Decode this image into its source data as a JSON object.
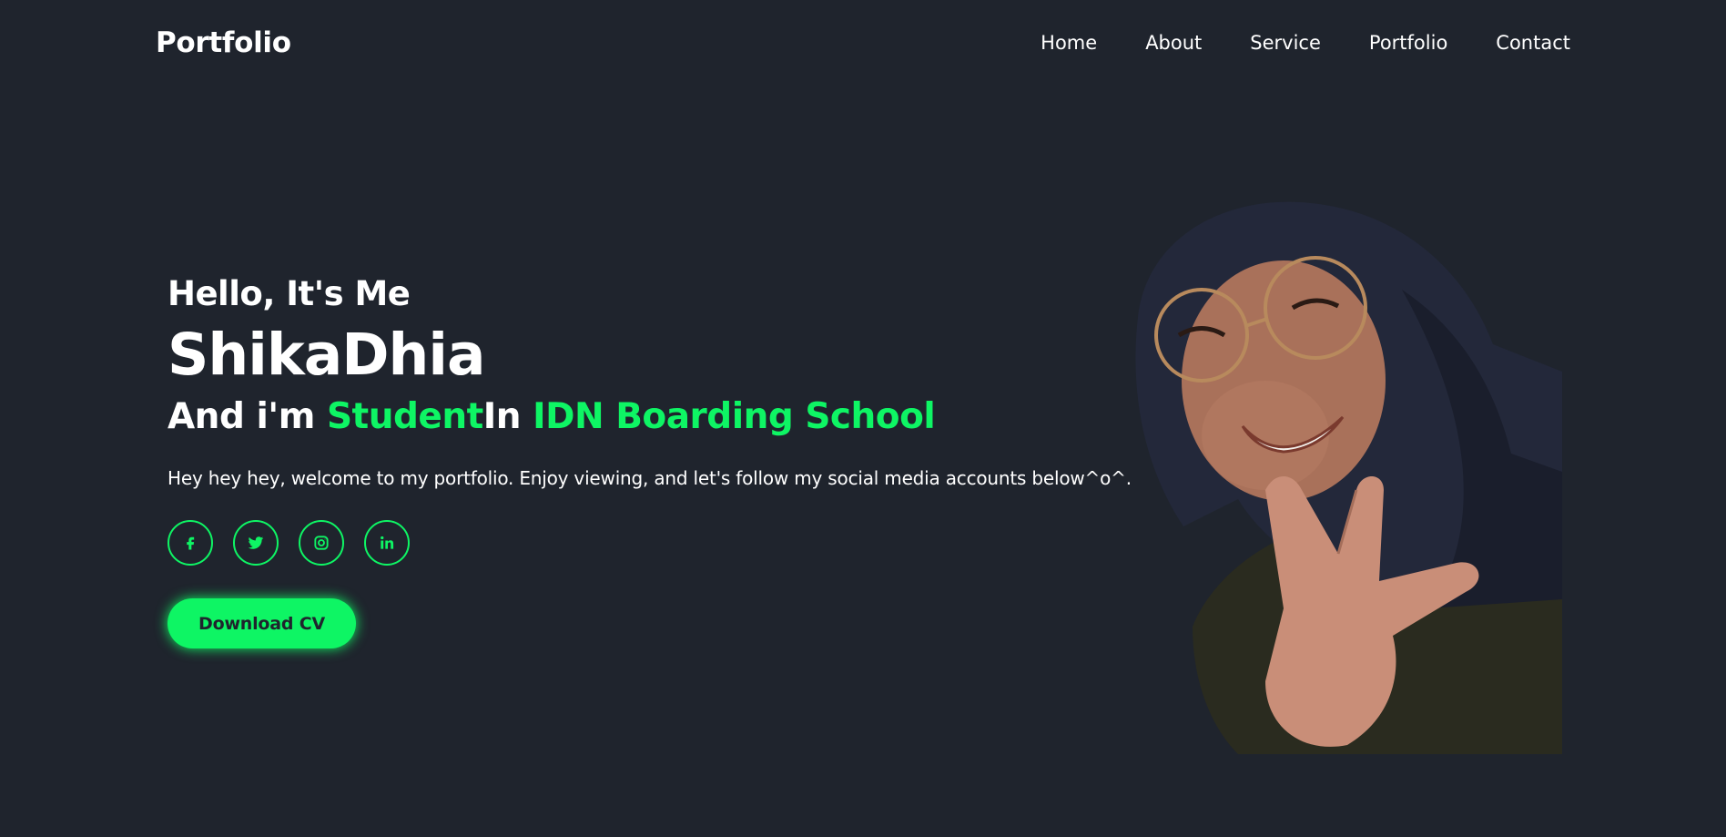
{
  "header": {
    "logo": "Portfolio",
    "nav": [
      "Home",
      "About",
      "Service",
      "Portfolio",
      "Contact"
    ]
  },
  "home": {
    "greeting": "Hello, It's Me",
    "name": "ShikaDhia",
    "role_prefix": "And i'm ",
    "role_accent": "Student",
    "role_middle": "In ",
    "role_school": "IDN Boarding School",
    "intro": "Hey hey hey, welcome to my portfolio. Enjoy viewing, and let's follow my social media accounts below^o^.",
    "social_icons": [
      "facebook-icon",
      "twitter-icon",
      "instagram-icon",
      "linkedin-icon"
    ],
    "button_label": "Download CV"
  },
  "colors": {
    "background": "#1f242d",
    "accent": "#0ef564",
    "text": "#ffffff"
  }
}
